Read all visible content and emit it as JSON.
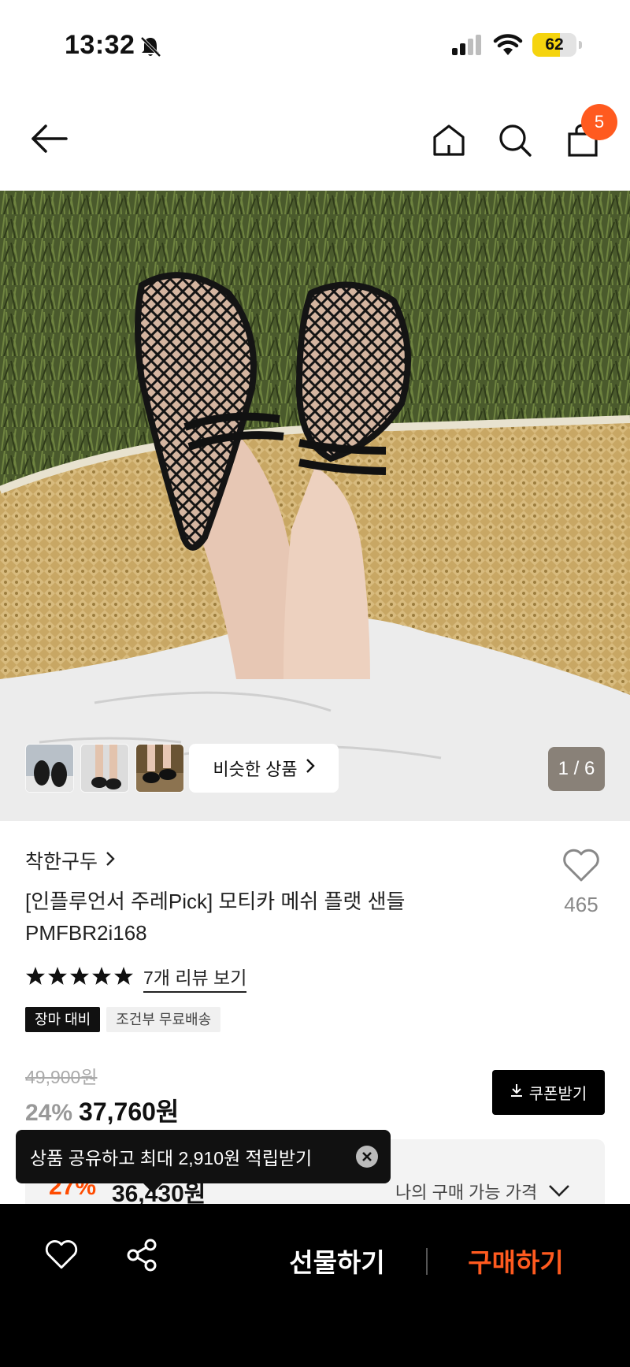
{
  "status_bar": {
    "time": "13:32",
    "battery": "62",
    "battery_level": 0.62
  },
  "nav": {
    "cart_count": "5"
  },
  "gallery": {
    "similar_label": "비슷한 상품",
    "pager": "1 / 6"
  },
  "product": {
    "brand": "착한구두",
    "title": "[인플루언서 주레Pick] 모티카 메쉬 플랫 샌들 PMFBR2i168",
    "like_count": "465",
    "rating_stars": 5,
    "review_link": "7개 리뷰 보기",
    "tags": [
      "장마 대비",
      "조건부 무료배송"
    ],
    "original_price": "49,900원",
    "discount": "24%",
    "price": "37,760원",
    "coupon_label": "쿠폰받기"
  },
  "my_price": {
    "label": "나의 구매 가능 가격",
    "peek_discount": "27%",
    "peek_price": "36,430원"
  },
  "toast": {
    "text": "상품 공유하고 최대 2,910원 적립받기"
  },
  "bottom_bar": {
    "gift_label": "선물하기",
    "buy_label": "구매하기"
  },
  "colors": {
    "accent": "#ff5a1f",
    "dark": "#000000",
    "tag_black": "#111111"
  }
}
